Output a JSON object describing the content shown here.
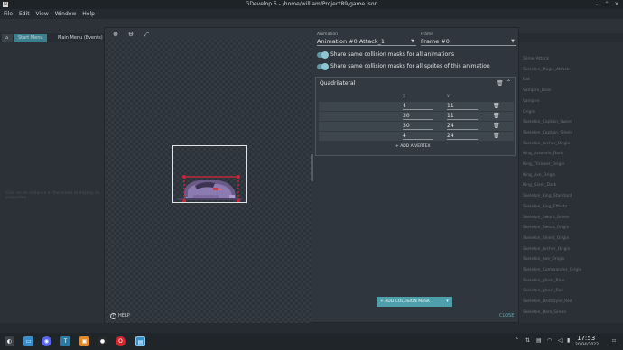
{
  "window": {
    "title": "GDevelop 5 - /home/william/Project89/game.json",
    "app_icon": "N"
  },
  "menu": [
    "File",
    "Edit",
    "View",
    "Window",
    "Help"
  ],
  "background": {
    "tabs": [
      "Start Menu",
      "Main Menu (Events)"
    ],
    "placeholder": "Click on an instance in the scene to display its properties",
    "objects": [
      "Slime_Attack",
      "Skeleton_Magic_Attack",
      "Bat",
      "Vampire_Boss",
      "Vampire",
      "Origin",
      "Skeleton_Captain_Sword",
      "Skeleton_Captain_Shield",
      "Skeleton_Archer_Origin",
      "King_Assassin_Dark",
      "King_Thrower_Origin",
      "King_Axe_Origin",
      "King_Giant_Dark",
      "Skeleton_King_Standard",
      "Skeleton_King_Effects",
      "Skeleton_Sword_Green",
      "Skeleton_Sword_Origin",
      "Skeleton_Shield_Origin",
      "Skeleton_Archer_Origin",
      "Skeleton_Axe_Origin",
      "Skeleton_Commander_Origin",
      "Skeleton_ghost_Blue",
      "Skeleton_ghost_Red",
      "Skeleton_Destroyer_Red",
      "Skeleton_Hero_Green"
    ]
  },
  "modal": {
    "animation": {
      "label": "Animation",
      "value": "Animation #0 Attack_1"
    },
    "frame": {
      "label": "Frame",
      "value": "Frame #0"
    },
    "toggles": [
      {
        "label": "Share same collision masks for all animations",
        "on": true
      },
      {
        "label": "Share same collision masks for all sprites of this animation",
        "on": true
      }
    ],
    "mask": {
      "title": "Quadrilateral",
      "col_x": "X",
      "col_y": "Y",
      "vertices": [
        {
          "x": "4",
          "y": "11"
        },
        {
          "x": "30",
          "y": "11"
        },
        {
          "x": "30",
          "y": "24"
        },
        {
          "x": "4",
          "y": "24"
        }
      ],
      "add_vertex": "ADD A VERTEX"
    },
    "add_collision_mask": "ADD COLLISION MASK",
    "help": "HELP",
    "close": "CLOSE"
  },
  "taskbar": {
    "time": "17:53",
    "date": "20/04/2022"
  },
  "colors": {
    "accent": "#4f9eac",
    "toggle": "#5e98a6",
    "mask_points": "#c0283a"
  }
}
